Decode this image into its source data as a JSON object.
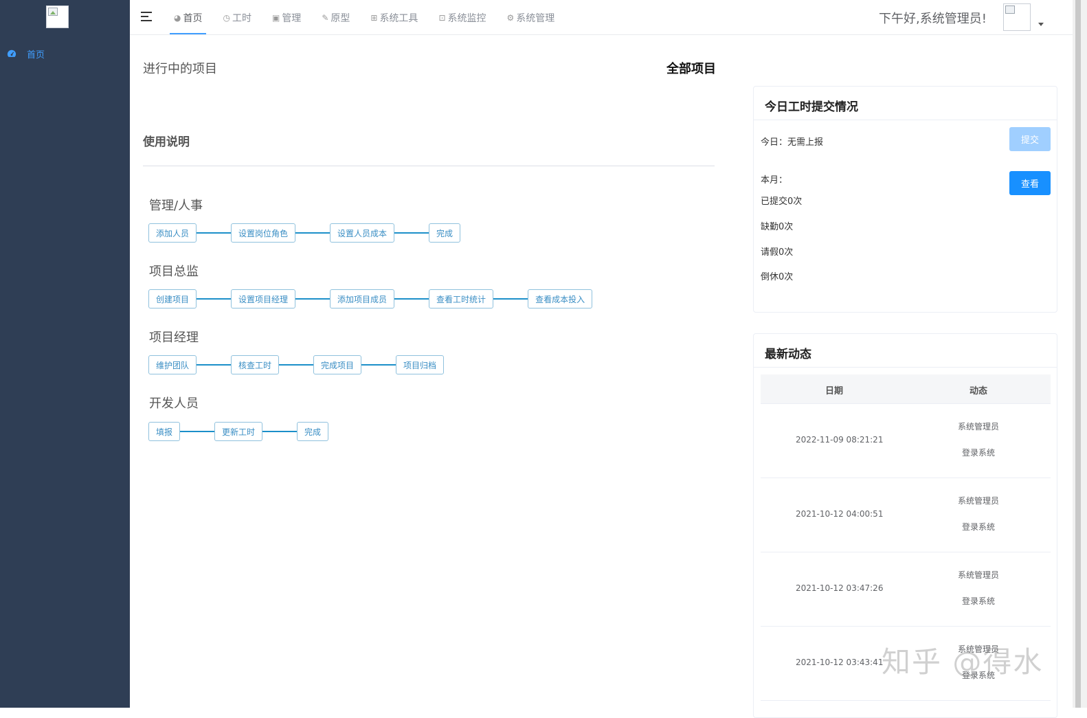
{
  "sidebar": {
    "logo_icon": "broken-image-icon",
    "items": [
      {
        "label": "首页",
        "icon": "dashboard-icon"
      }
    ]
  },
  "header": {
    "tabs": [
      {
        "label": "首页",
        "icon": "dashboard-icon",
        "glyph": "◕",
        "active": true
      },
      {
        "label": "工时",
        "icon": "clock-icon",
        "glyph": "◷",
        "active": false
      },
      {
        "label": "管理",
        "icon": "image-icon",
        "glyph": "▣",
        "active": false
      },
      {
        "label": "原型",
        "icon": "edit-icon",
        "glyph": "✎",
        "active": false
      },
      {
        "label": "系统工具",
        "icon": "toolbox-icon",
        "glyph": "⊞",
        "active": false
      },
      {
        "label": "系统监控",
        "icon": "monitor-icon",
        "glyph": "⊡",
        "active": false
      },
      {
        "label": "系统管理",
        "icon": "gear-icon",
        "glyph": "⚙",
        "active": false
      }
    ],
    "greeting": "下午好,系统管理员!",
    "avatar_icon": "broken-image-icon"
  },
  "main": {
    "ongoing_label": "进行中的项目",
    "all_projects_label": "全部项目",
    "usage_title": "使用说明",
    "roles": [
      {
        "title": "管理/人事",
        "steps": [
          "添加人员",
          "设置岗位角色",
          "设置人员成本",
          "完成"
        ]
      },
      {
        "title": "项目总监",
        "steps": [
          "创建项目",
          "设置项目经理",
          "添加项目成员",
          "查看工时统计",
          "查看成本投入"
        ]
      },
      {
        "title": "项目经理",
        "steps": [
          "维护团队",
          "核查工时",
          "完成项目",
          "项目归档"
        ]
      },
      {
        "title": "开发人员",
        "steps": [
          "填报",
          "更新工时",
          "完成"
        ]
      }
    ]
  },
  "timesheet": {
    "title": "今日工时提交情况",
    "today": "今日：无需上报",
    "submit_label": "提交",
    "month_label": "本月：",
    "view_label": "查看",
    "submitted": "已提交0次",
    "absent": "缺勤0次",
    "leave": "请假0次",
    "rest": "倒休0次"
  },
  "activity": {
    "title": "最新动态",
    "columns": [
      "日期",
      "动态"
    ],
    "rows": [
      {
        "date": "2022-11-09 08:21:21",
        "user": "系统管理员",
        "action": "登录系统"
      },
      {
        "date": "2021-10-12 04:00:51",
        "user": "系统管理员",
        "action": "登录系统"
      },
      {
        "date": "2021-10-12 03:47:26",
        "user": "系统管理员",
        "action": "登录系统"
      },
      {
        "date": "2021-10-12 03:43:41",
        "user": "系统管理员",
        "action": "登录系统"
      }
    ]
  },
  "watermark": "知乎 @得水",
  "colors": {
    "sidebar_bg": "#2f3e55",
    "accent": "#409eff",
    "primary_button": "#1890ff",
    "step_line": "#1b8fc9"
  }
}
